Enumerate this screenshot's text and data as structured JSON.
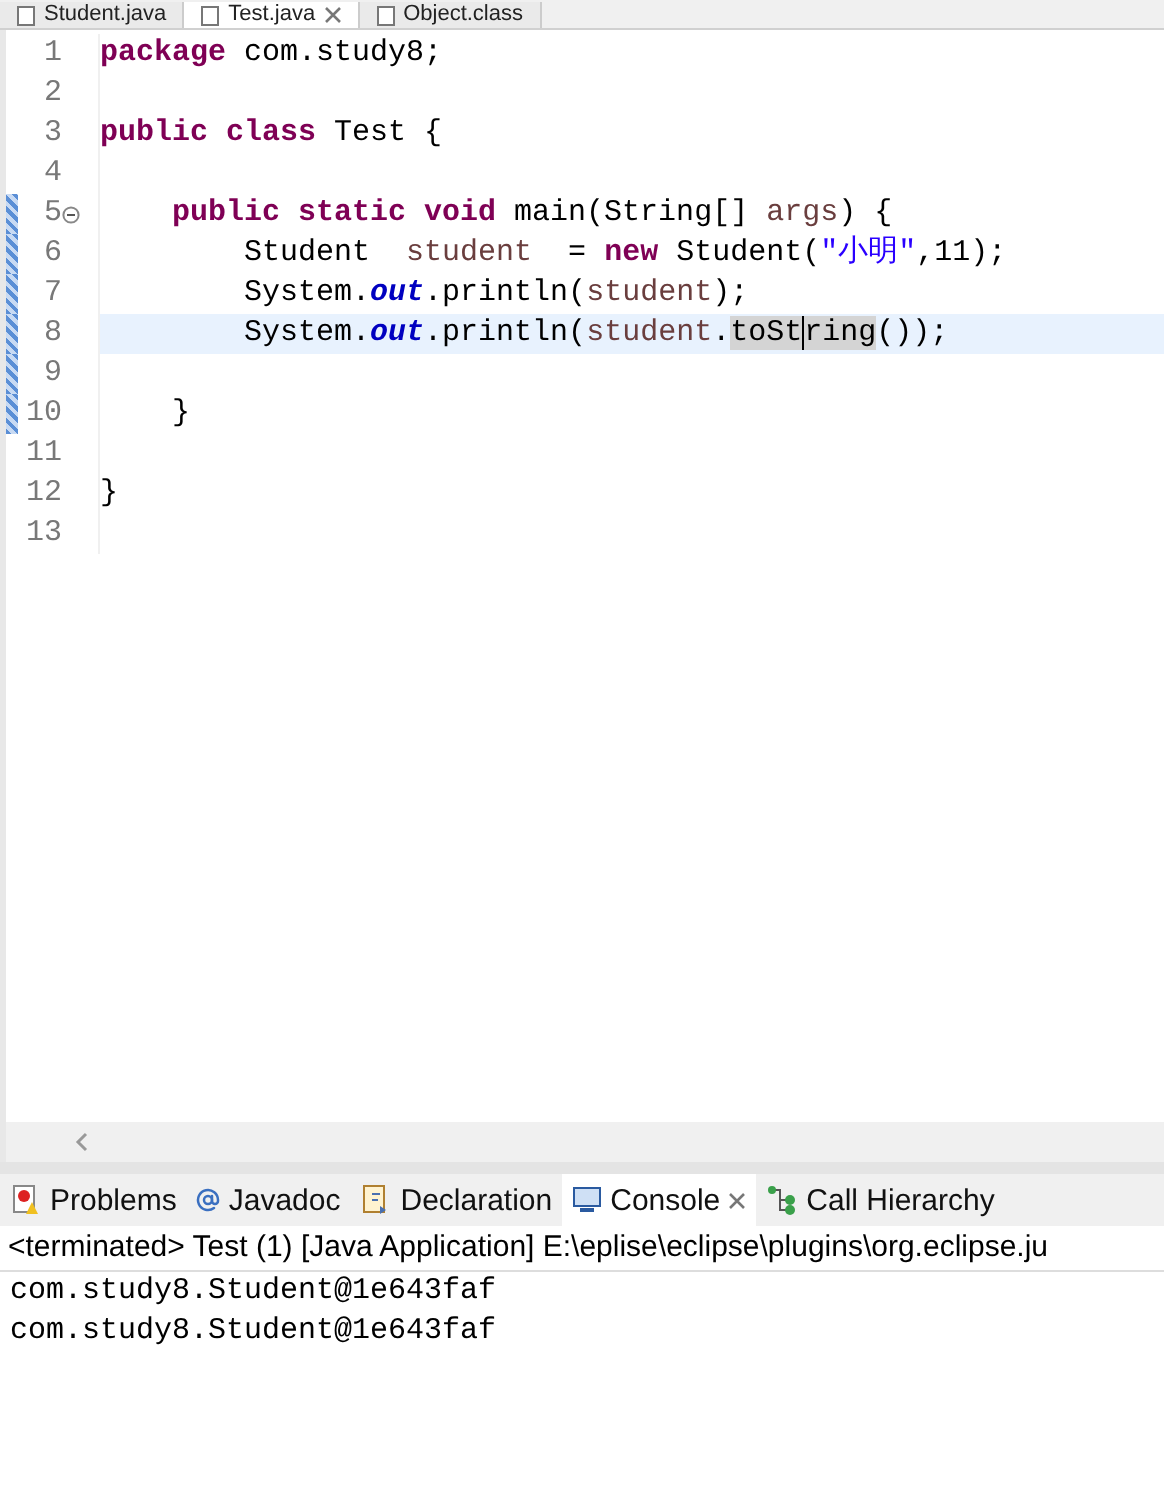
{
  "editor_tabs": [
    {
      "label": "Student.java",
      "selected": false,
      "closable": false
    },
    {
      "label": "Test.java",
      "selected": true,
      "closable": true
    },
    {
      "label": "Object.class",
      "selected": false,
      "closable": false
    }
  ],
  "code_lines": [
    {
      "number": "1",
      "current": false,
      "fold": false,
      "changed": false,
      "segments": [
        {
          "kind": "keyword",
          "text": "package"
        },
        {
          "kind": "plain",
          "text": " com.study8;"
        }
      ]
    },
    {
      "number": "2",
      "current": false,
      "fold": false,
      "changed": false
    },
    {
      "number": "3",
      "current": false,
      "fold": false,
      "changed": false,
      "segments": [
        {
          "kind": "keyword",
          "text": "public class"
        },
        {
          "kind": "plain",
          "text": " Test {"
        }
      ]
    },
    {
      "number": "4",
      "current": false,
      "fold": false,
      "changed": false
    },
    {
      "number": "5",
      "current": false,
      "fold": true,
      "changed": true,
      "segments": [
        {
          "kind": "keyword",
          "text": "    public static void"
        },
        {
          "kind": "plain",
          "text": " main(String[] "
        },
        {
          "kind": "local",
          "text": "args"
        },
        {
          "kind": "plain",
          "text": ") {"
        }
      ]
    },
    {
      "number": "6",
      "current": false,
      "fold": false,
      "changed": true,
      "segments": [
        {
          "kind": "plain",
          "text": "        Student  "
        },
        {
          "kind": "local",
          "text": "student"
        },
        {
          "kind": "plain",
          "text": "  = "
        },
        {
          "kind": "keyword",
          "text": "new"
        },
        {
          "kind": "plain",
          "text": " Student("
        },
        {
          "kind": "string",
          "text": "\"小明\""
        },
        {
          "kind": "plain",
          "text": ",11);"
        }
      ]
    },
    {
      "number": "7",
      "current": false,
      "fold": false,
      "changed": true,
      "segments": [
        {
          "kind": "plain",
          "text": "        System."
        },
        {
          "kind": "field",
          "text": "out"
        },
        {
          "kind": "plain",
          "text": ".println("
        },
        {
          "kind": "local",
          "text": "student"
        },
        {
          "kind": "plain",
          "text": ");"
        }
      ]
    },
    {
      "number": "8",
      "current": true,
      "fold": false,
      "changed": true,
      "segments": [
        {
          "kind": "plain",
          "text": "        System."
        },
        {
          "kind": "field",
          "text": "out"
        },
        {
          "kind": "plain",
          "text": ".println("
        },
        {
          "kind": "local",
          "text": "student"
        },
        {
          "kind": "plain",
          "text": "."
        },
        {
          "kind": "occurrence",
          "text": "toSt",
          "caret_after": true
        },
        {
          "kind": "occurrence",
          "text": "ring"
        },
        {
          "kind": "plain",
          "text": "());"
        }
      ]
    },
    {
      "number": "9",
      "current": false,
      "fold": false,
      "changed": true
    },
    {
      "number": "10",
      "current": false,
      "fold": false,
      "changed": true,
      "segments": [
        {
          "kind": "plain",
          "text": "    }"
        }
      ]
    },
    {
      "number": "11",
      "current": false,
      "fold": false,
      "changed": false
    },
    {
      "number": "12",
      "current": false,
      "fold": false,
      "changed": false,
      "segments": [
        {
          "kind": "plain",
          "text": "}"
        }
      ]
    },
    {
      "number": "13",
      "current": false,
      "fold": false,
      "changed": false
    }
  ],
  "panel_tabs": [
    {
      "label": "Problems",
      "kind": "problems",
      "selected": false,
      "closable": false
    },
    {
      "label": "Javadoc",
      "kind": "javadoc",
      "selected": false,
      "closable": false
    },
    {
      "label": "Declaration",
      "kind": "declaration",
      "selected": false,
      "closable": false
    },
    {
      "label": "Console",
      "kind": "console",
      "selected": true,
      "closable": true
    },
    {
      "label": "Call Hierarchy",
      "kind": "hierarchy",
      "selected": false,
      "closable": false
    }
  ],
  "console": {
    "header": "<terminated> Test (1) [Java Application] E:\\eplise\\eclipse\\plugins\\org.eclipse.ju",
    "output": [
      "com.study8.Student@1e643faf",
      "com.study8.Student@1e643faf"
    ]
  }
}
